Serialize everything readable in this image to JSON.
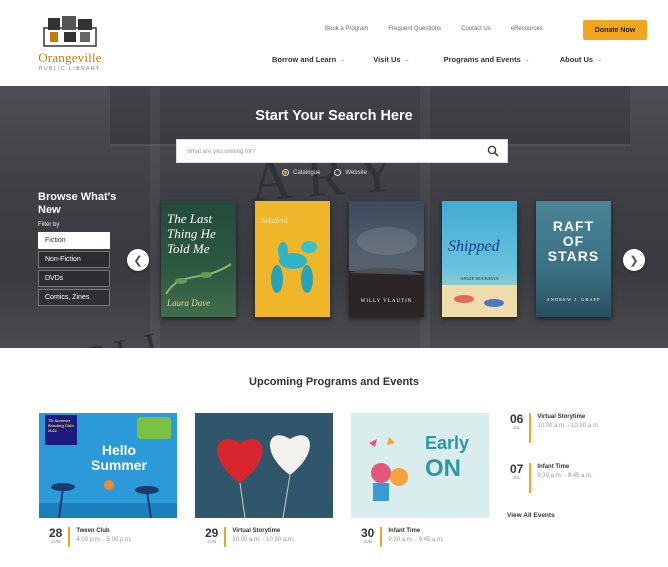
{
  "header": {
    "logo": {
      "name": "Orangeville",
      "subtitle": "PUBLIC LIBRARY"
    },
    "utility_nav": [
      "Book a Program",
      "Frequent Questions",
      "Contact Us",
      "eResources"
    ],
    "donate_label": "Donate Now",
    "main_nav": [
      {
        "label": "Borrow and Learn"
      },
      {
        "label": "Visit Us"
      },
      {
        "label": "Programs and Events"
      },
      {
        "label": "About Us"
      }
    ]
  },
  "hero": {
    "title": "Start Your Search Here",
    "search_placeholder": "What are you looking for?",
    "search_options": [
      {
        "label": "Catalogue",
        "checked": true
      },
      {
        "label": "Website",
        "checked": false
      }
    ],
    "browse": {
      "title": "Browse What's New",
      "filter_label": "Filter by",
      "filters": [
        {
          "label": "Fiction",
          "active": true
        },
        {
          "label": "Non-Fiction",
          "active": false
        },
        {
          "label": "DVDs",
          "active": false
        },
        {
          "label": "Comics, Zines",
          "active": false
        }
      ]
    },
    "books": [
      {
        "title": "The Last Thing He Told Me",
        "author": "Laura Dave"
      },
      {
        "title": "Seinfeld",
        "author": ""
      },
      {
        "title": "",
        "author": "WILLY VLAUTIN"
      },
      {
        "title": "Shipped",
        "author": "ANGIE HOCKMAN"
      },
      {
        "title": "RAFT OF STARS",
        "author": "ANDREW J. GRAFF"
      }
    ]
  },
  "events": {
    "title": "Upcoming Programs and Events",
    "cards": [
      {
        "day": "28",
        "month": "JUN",
        "name": "Tween Club",
        "time": "4:00 p.m. - 5:00 p.m.",
        "image_text": "Hello Summer",
        "badge": "TD Summer Reading Club 2022"
      },
      {
        "day": "29",
        "month": "JUN",
        "name": "Virtual Storytime",
        "time": "10:00 a.m. - 10:30 a.m."
      },
      {
        "day": "30",
        "month": "JUN",
        "name": "Infant Time",
        "time": "9:30 a.m. - 9:45 a.m.",
        "image_text_1": "Early",
        "image_text_2": "ON"
      }
    ],
    "side": [
      {
        "day": "06",
        "month": "JUL",
        "name": "Virtual Storytime",
        "time": "10:00 a.m. - 10:30 a.m."
      },
      {
        "day": "07",
        "month": "JUL",
        "name": "Infant Time",
        "time": "9:30 a.m. - 9:45 a.m."
      }
    ],
    "view_all": "View All Events"
  },
  "colors": {
    "accent": "#f2a51e",
    "logo_orange": "#c57a0b"
  }
}
